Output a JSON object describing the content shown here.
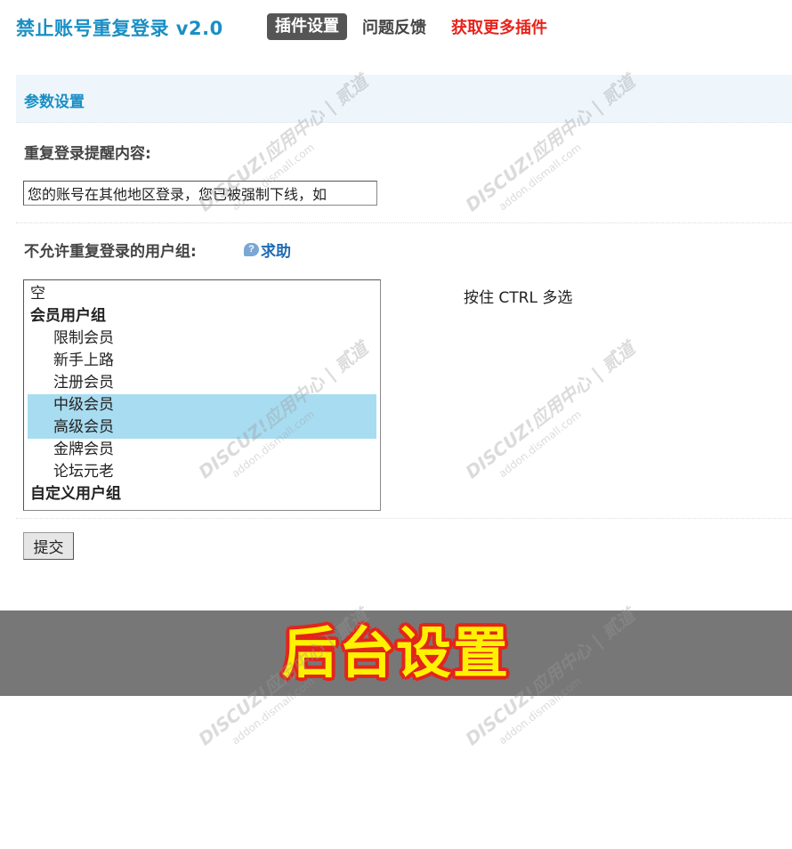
{
  "header": {
    "app_title": "禁止账号重复登录 v2.0",
    "nav": {
      "settings": "插件设置",
      "feedback": "问题反馈",
      "more_plugins": "获取更多插件"
    }
  },
  "section": {
    "title": "参数设置"
  },
  "form": {
    "reminder_label": "重复登录提醒内容:",
    "reminder_value": "您的账号在其他地区登录，您已被强制下线，如",
    "groups_label": "不允许重复登录的用户组:",
    "help_label": "求助",
    "help_icon": "help-bubble-icon",
    "hint": "按住 CTRL 多选",
    "options": {
      "empty": "空",
      "member_group": "会员用户组",
      "restricted": "限制会员",
      "newbie": "新手上路",
      "registered": "注册会员",
      "mid": "中级会员",
      "senior": "高级会员",
      "gold": "金牌会员",
      "veteran": "论坛元老",
      "custom_group": "自定义用户组"
    },
    "selected": [
      "中级会员",
      "高级会员"
    ],
    "submit_label": "提交"
  },
  "banner": {
    "text": "后台设置"
  },
  "watermark": {
    "brand": "DISCUZ!应用中心 | 贰道",
    "url": "addon.dismall.com"
  },
  "colors": {
    "accent": "#1a8fc4",
    "nav_active_bg": "#555555",
    "nav_red": "#e8231b",
    "selection": "#a8dcf0",
    "banner_bg": "#777777",
    "banner_text": "#fff200",
    "banner_outline": "#e3241b"
  }
}
